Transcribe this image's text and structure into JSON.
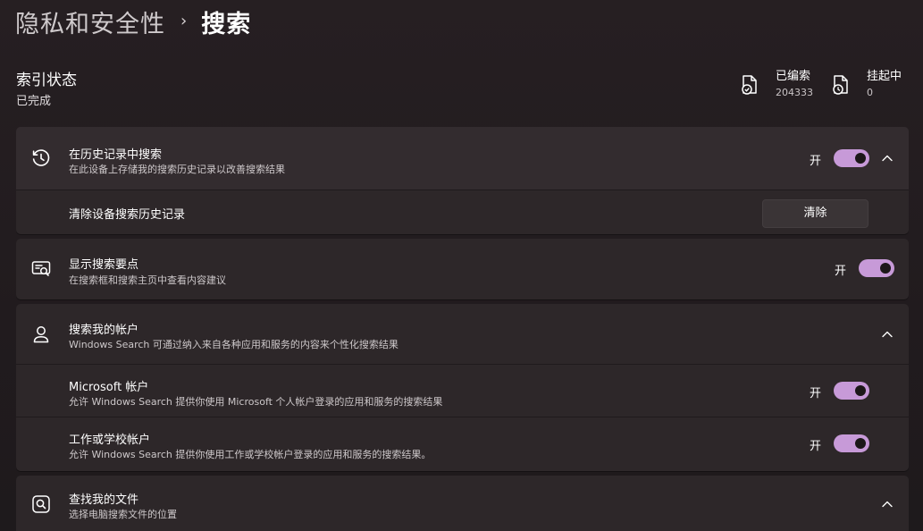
{
  "breadcrumb": {
    "parent": "隐私和安全性",
    "separator": "›",
    "current": "搜索"
  },
  "index_status": {
    "title": "索引状态",
    "status": "已完成",
    "indexed_label": "已编索",
    "indexed_value": "204333",
    "pending_label": "挂起中",
    "pending_value": "0"
  },
  "history": {
    "title": "在历史记录中搜索",
    "desc": "在此设备上存储我的搜索历史记录以改善搜索结果",
    "toggle_label": "开",
    "toggle_on": true,
    "clear_title": "清除设备搜索历史记录",
    "clear_button": "清除"
  },
  "highlights": {
    "title": "显示搜索要点",
    "desc": "在搜索框和搜索主页中查看内容建议",
    "toggle_label": "开",
    "toggle_on": true
  },
  "accounts": {
    "title": "搜索我的帐户",
    "desc": "Windows Search 可通过纳入来自各种应用和服务的内容来个性化搜索结果",
    "microsoft_title": "Microsoft 帐户",
    "microsoft_desc": "允许 Windows Search 提供你使用 Microsoft 个人帐户登录的应用和服务的搜索结果",
    "microsoft_toggle_label": "开",
    "work_title": "工作或学校帐户",
    "work_desc": "允许 Windows Search 提供你使用工作或学校帐户登录的应用和服务的搜索结果。",
    "work_toggle_label": "开"
  },
  "files": {
    "title": "查找我的文件",
    "desc": "选择电脑搜索文件的位置"
  },
  "colors": {
    "accent": "#c79ad8",
    "card": "#2d2729",
    "background": "#221d1f"
  },
  "icons": [
    "history-icon",
    "search-highlights-icon",
    "person-icon",
    "search-files-icon",
    "chevron-up-icon",
    "document-check-icon",
    "document-pending-icon"
  ]
}
